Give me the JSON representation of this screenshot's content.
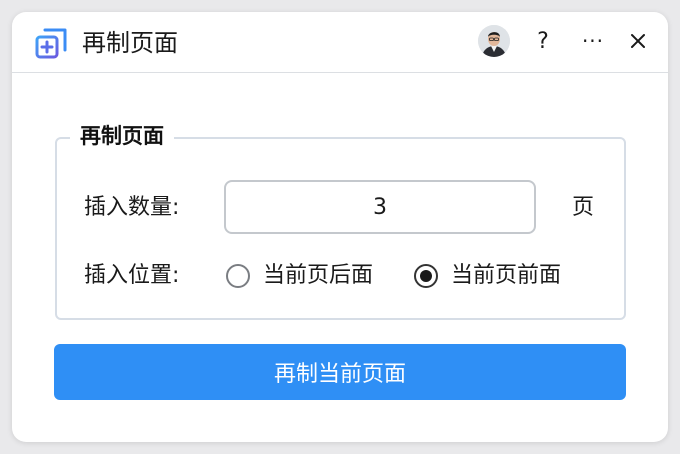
{
  "window": {
    "title": "再制页面",
    "icons": {
      "app": "duplicate-page-icon",
      "avatar": "user-avatar",
      "help": "?",
      "more": "···",
      "close": "close-icon"
    }
  },
  "group": {
    "legend": "再制页面",
    "quantity_label": "插入数量:",
    "quantity_value": "3",
    "quantity_unit": "页",
    "position_label": "插入位置:",
    "position_options": [
      {
        "label": "当前页后面",
        "checked": false
      },
      {
        "label": "当前页前面",
        "checked": true
      }
    ]
  },
  "action": {
    "submit_label": "再制当前页面"
  },
  "colors": {
    "accent": "#2f8ff5",
    "border": "#d6dde6",
    "icon_blue": "#3b8cf5",
    "icon_purple": "#6a5ae0"
  }
}
